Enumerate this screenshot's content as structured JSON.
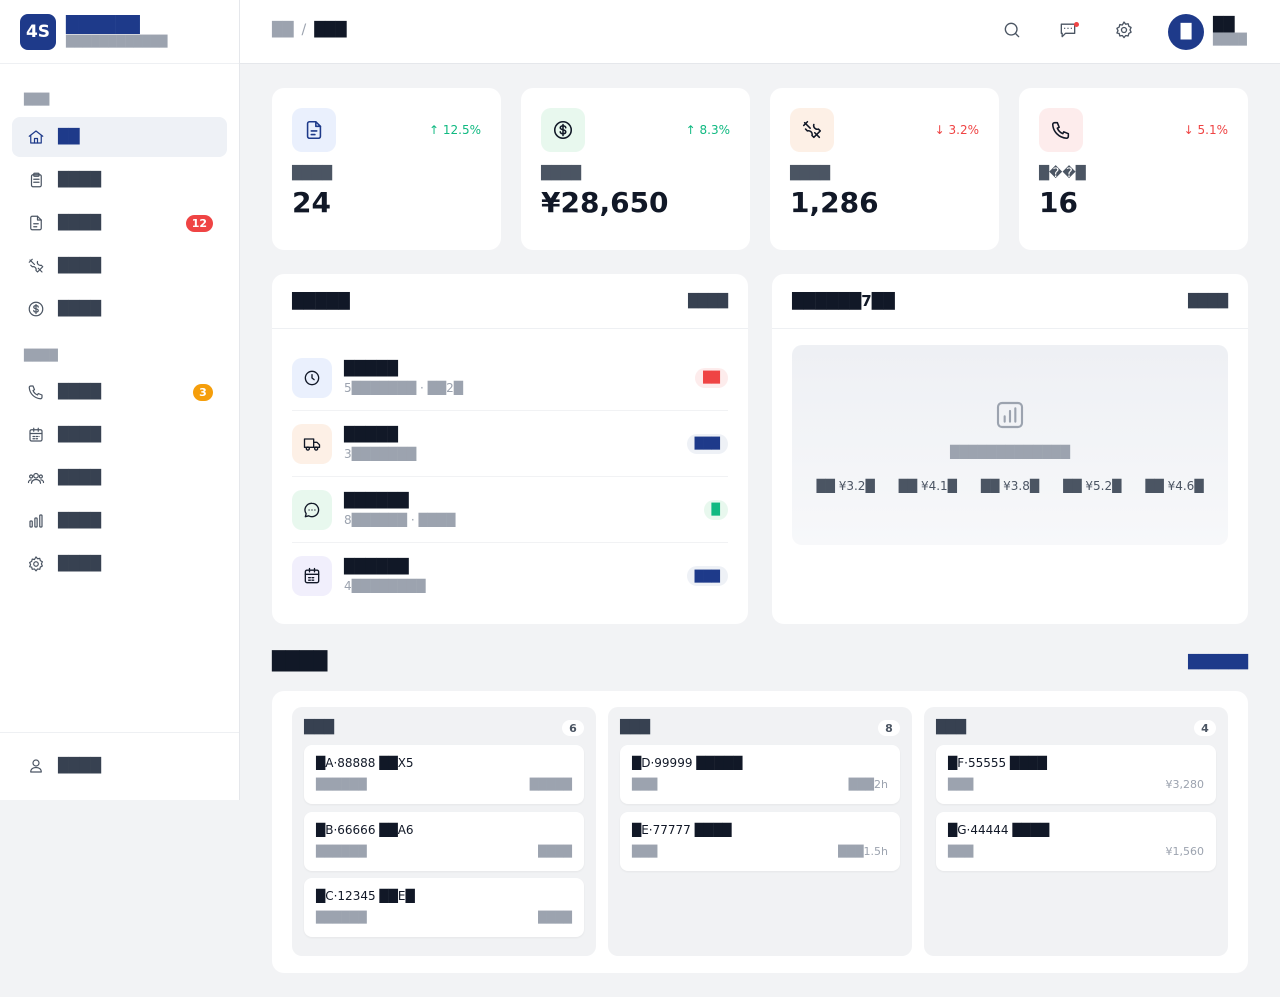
{
  "brand": {
    "logo_text": "4S",
    "name": "██████",
    "subtitle": "████████████"
  },
  "sidebar": {
    "section1": "███",
    "section2": "████",
    "items": [
      {
        "label": "██",
        "icon": "home-icon"
      },
      {
        "label": "████",
        "icon": "clipboard-icon"
      },
      {
        "label": "████",
        "icon": "document-icon",
        "badge": "12"
      },
      {
        "label": "████",
        "icon": "tools-icon"
      },
      {
        "label": "████",
        "icon": "dollar-icon"
      },
      {
        "label": "████",
        "icon": "phone-icon",
        "badge": "3"
      },
      {
        "label": "████",
        "icon": "calendar-icon"
      },
      {
        "label": "████",
        "icon": "users-icon"
      },
      {
        "label": "████",
        "icon": "bar-chart-icon"
      },
      {
        "label": "████",
        "icon": "gear-icon"
      }
    ],
    "footer_label": "████"
  },
  "header": {
    "breadcrumb_root": "██",
    "breadcrumb_sep": "/",
    "breadcrumb_current": "███",
    "avatar_text": "█",
    "user_name": "██",
    "user_role": "████"
  },
  "stats": [
    {
      "label": "████",
      "value": "24",
      "trend": "↑ 12.5%",
      "icon": "document-icon"
    },
    {
      "label": "████",
      "value": "¥28,650",
      "trend": "↑ 8.3%",
      "icon": "dollar-circle-icon"
    },
    {
      "label": "████",
      "value": "1,286",
      "trend": "↓ 3.2%",
      "icon": "tools-icon"
    },
    {
      "label": "█��█",
      "value": "16",
      "trend": "↓ 5.1%",
      "icon": "phone-icon"
    }
  ],
  "tasks_panel": {
    "title": "█████",
    "link": "████",
    "items": [
      {
        "title": "█████",
        "sub": "5███████ · ██2█",
        "tag": "██",
        "icon": "clock-icon"
      },
      {
        "title": "█████",
        "sub": "3███████",
        "tag": "███",
        "icon": "truck-icon"
      },
      {
        "title": "██████",
        "sub": "8██████ · ████",
        "tag": "█",
        "icon": "chat-icon"
      },
      {
        "title": "██████",
        "sub": "4████████",
        "tag": "███",
        "icon": "calendar-icon"
      }
    ]
  },
  "chart_panel": {
    "title": "██████7██",
    "link": "████",
    "hint": "█████████████",
    "values": [
      "██ ¥3.2█",
      "██ ¥4.1█",
      "██ ¥3.8█",
      "██ ¥5.2█",
      "██ ¥4.6█"
    ]
  },
  "kanban": {
    "title": "████",
    "link": "██████",
    "columns": [
      {
        "name": "███",
        "count": "6",
        "cards": [
          {
            "title": "█A·88888 ██X5",
            "sub": "██████",
            "right": "█████"
          },
          {
            "title": "█B·66666 ██A6",
            "sub": "██████",
            "right": "████"
          },
          {
            "title": "█C·12345 ██E█",
            "sub": "██████",
            "right": "████"
          }
        ]
      },
      {
        "name": "███",
        "count": "8",
        "cards": [
          {
            "title": "█D·99999 █████",
            "sub": "███",
            "right": "███2h"
          },
          {
            "title": "█E·77777 ████",
            "sub": "███",
            "right": "███1.5h"
          }
        ]
      },
      {
        "name": "███",
        "count": "4",
        "cards": [
          {
            "title": "█F·55555 ████",
            "sub": "███",
            "right": "¥3,280"
          },
          {
            "title": "█G·44444 ████",
            "sub": "███",
            "right": "¥1,560"
          }
        ]
      }
    ]
  },
  "colors": {
    "brand": "#1e3a8a",
    "badge_red": "#ef4444",
    "badge_orange": "#f59e0b",
    "trend_up": "#10b981",
    "trend_down": "#ef4444"
  }
}
